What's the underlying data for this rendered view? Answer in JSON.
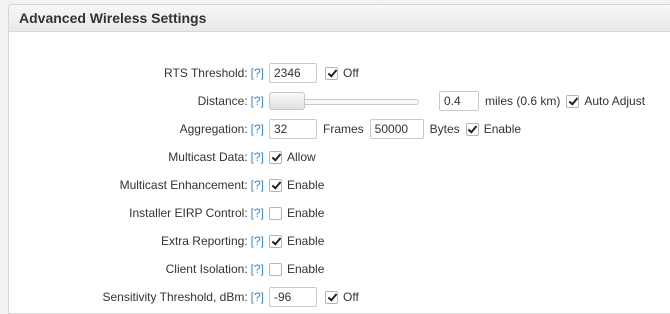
{
  "panel": {
    "title": "Advanced Wireless Settings"
  },
  "help_label": "[?]",
  "rts": {
    "label": "RTS Threshold:",
    "value": "2346",
    "off_checked": true,
    "off_label": "Off"
  },
  "distance": {
    "label": "Distance:",
    "value": "0.4",
    "unit": "miles (0.6 km)",
    "auto_checked": true,
    "auto_label": "Auto Adjust",
    "slider_level": 0.0
  },
  "aggregation": {
    "label": "Aggregation:",
    "frames_value": "32",
    "frames_label": "Frames",
    "bytes_value": "50000",
    "bytes_label": "Bytes",
    "enable_checked": true,
    "enable_label": "Enable"
  },
  "multicast_data": {
    "label": "Multicast Data:",
    "checked": true,
    "option": "Allow"
  },
  "multicast_enhancement": {
    "label": "Multicast Enhancement:",
    "checked": true,
    "option": "Enable"
  },
  "installer_eirp": {
    "label": "Installer EIRP Control:",
    "checked": false,
    "option": "Enable"
  },
  "extra_reporting": {
    "label": "Extra Reporting:",
    "checked": true,
    "option": "Enable"
  },
  "client_isolation": {
    "label": "Client Isolation:",
    "checked": false,
    "option": "Enable"
  },
  "sensitivity": {
    "label": "Sensitivity Threshold, dBm:",
    "value": "-96",
    "off_checked": true,
    "off_label": "Off"
  },
  "colors": {
    "help_link": "#3a86c4",
    "panel_bg": "#ffffff",
    "page_bg": "#f2f2f2"
  }
}
